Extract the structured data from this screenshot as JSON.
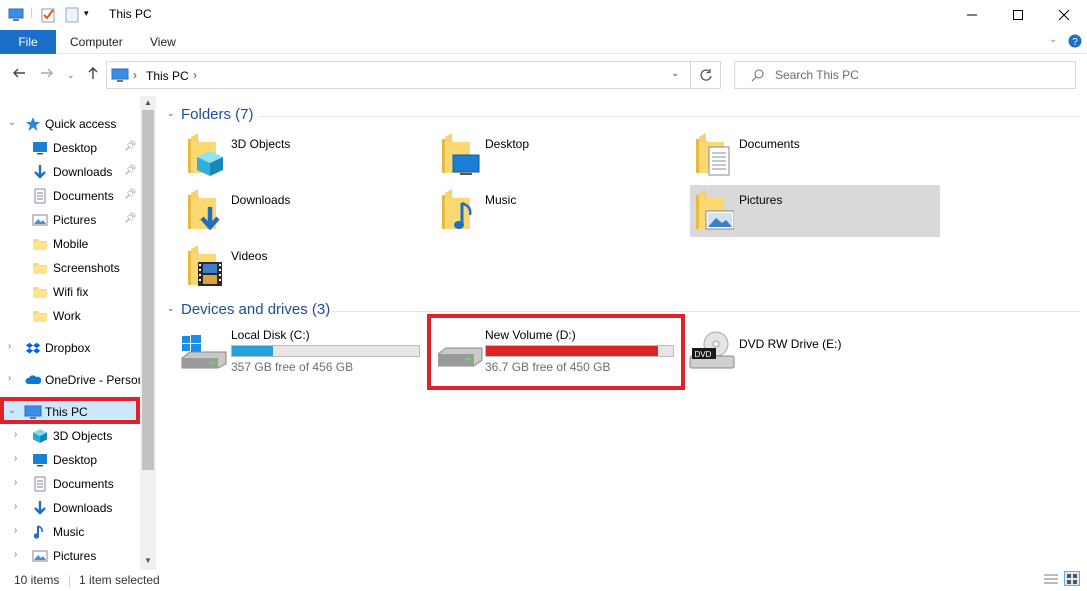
{
  "window": {
    "title": "This PC"
  },
  "ribbon": {
    "tabs": [
      "File",
      "Computer",
      "View"
    ]
  },
  "address": {
    "path": [
      "This PC"
    ]
  },
  "search": {
    "placeholder": "Search This PC"
  },
  "sidebar": {
    "quick_access": "Quick access",
    "quick_items": [
      {
        "label": "Desktop",
        "icon": "desktop-icon",
        "pinned": true
      },
      {
        "label": "Downloads",
        "icon": "downloads-icon",
        "pinned": true
      },
      {
        "label": "Documents",
        "icon": "documents-icon",
        "pinned": true
      },
      {
        "label": "Pictures",
        "icon": "pictures-icon",
        "pinned": true
      },
      {
        "label": "Mobile",
        "icon": "folder-icon",
        "pinned": false
      },
      {
        "label": "Screenshots",
        "icon": "folder-icon",
        "pinned": false
      },
      {
        "label": "Wifi fix",
        "icon": "folder-icon",
        "pinned": false
      },
      {
        "label": "Work",
        "icon": "folder-icon",
        "pinned": false
      }
    ],
    "dropbox": "Dropbox",
    "onedrive": "OneDrive - Persor",
    "this_pc": "This PC",
    "pc_items": [
      {
        "label": "3D Objects",
        "icon": "3d-objects-icon"
      },
      {
        "label": "Desktop",
        "icon": "desktop-icon"
      },
      {
        "label": "Documents",
        "icon": "documents-icon"
      },
      {
        "label": "Downloads",
        "icon": "downloads-icon"
      },
      {
        "label": "Music",
        "icon": "music-icon"
      },
      {
        "label": "Pictures",
        "icon": "pictures-icon"
      }
    ]
  },
  "content": {
    "folders_header": "Folders (7)",
    "folders": [
      {
        "label": "3D Objects",
        "icon": "3d-objects-folder-icon"
      },
      {
        "label": "Desktop",
        "icon": "desktop-folder-icon"
      },
      {
        "label": "Documents",
        "icon": "documents-folder-icon"
      },
      {
        "label": "Downloads",
        "icon": "downloads-folder-icon"
      },
      {
        "label": "Music",
        "icon": "music-folder-icon"
      },
      {
        "label": "Pictures",
        "icon": "pictures-folder-icon",
        "selected": true
      },
      {
        "label": "Videos",
        "icon": "videos-folder-icon"
      }
    ],
    "drives_header": "Devices and drives (3)",
    "drives": [
      {
        "name": "Local Disk (C:)",
        "free": "357 GB free of 456 GB",
        "used_fraction": 0.22,
        "bar_color": "#26a0da"
      },
      {
        "name": "New Volume (D:)",
        "free": "36.7 GB free of 450 GB",
        "used_fraction": 0.92,
        "bar_color": "#da2626"
      },
      {
        "name": "DVD RW Drive (E:)",
        "badge": "DVD"
      }
    ]
  },
  "status": {
    "items": "10 items",
    "selected": "1 item selected"
  },
  "colors": {
    "accent": "#1a6fc9",
    "highlight_box": "#e0202a",
    "selection": "#cce8ff"
  }
}
